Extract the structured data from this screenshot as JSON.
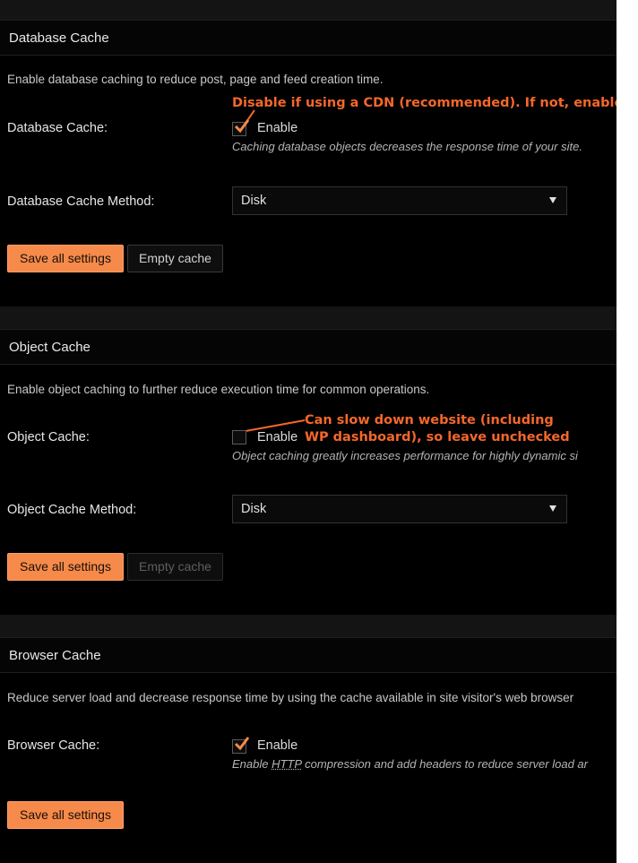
{
  "colors": {
    "accent": "#f58a4b",
    "annotation": "#f5672a",
    "background": "#000000"
  },
  "db": {
    "title": "Database Cache",
    "description": "Enable database caching to reduce post, page and feed creation time.",
    "cache_label": "Database Cache:",
    "enable_label": "Enable",
    "enabled": true,
    "hint": "Caching database objects decreases the response time of your site.",
    "method_label": "Database Cache Method:",
    "method_value": "Disk",
    "save_label": "Save all settings",
    "empty_label": "Empty cache",
    "annotation": "Disable if using a CDN (recommended). If not, enable"
  },
  "obj": {
    "title": "Object Cache",
    "description": "Enable object caching to further reduce execution time for common operations.",
    "cache_label": "Object Cache:",
    "enable_label": "Enable",
    "enabled": false,
    "hint": "Object caching greatly increases performance for highly dynamic si",
    "method_label": "Object Cache Method:",
    "method_value": "Disk",
    "save_label": "Save all settings",
    "empty_label": "Empty cache",
    "annotation_line1": "Can slow down website (including",
    "annotation_line2": "WP dashboard), so leave unchecked"
  },
  "browser": {
    "title": "Browser Cache",
    "description": "Reduce server load and decrease response time by using the cache available in site visitor's web browser",
    "cache_label": "Browser Cache:",
    "enable_label": "Enable",
    "enabled": true,
    "hint_pre": "Enable ",
    "hint_abbr": "HTTP",
    "hint_post": " compression and add headers to reduce server load ar",
    "save_label": "Save all settings"
  }
}
